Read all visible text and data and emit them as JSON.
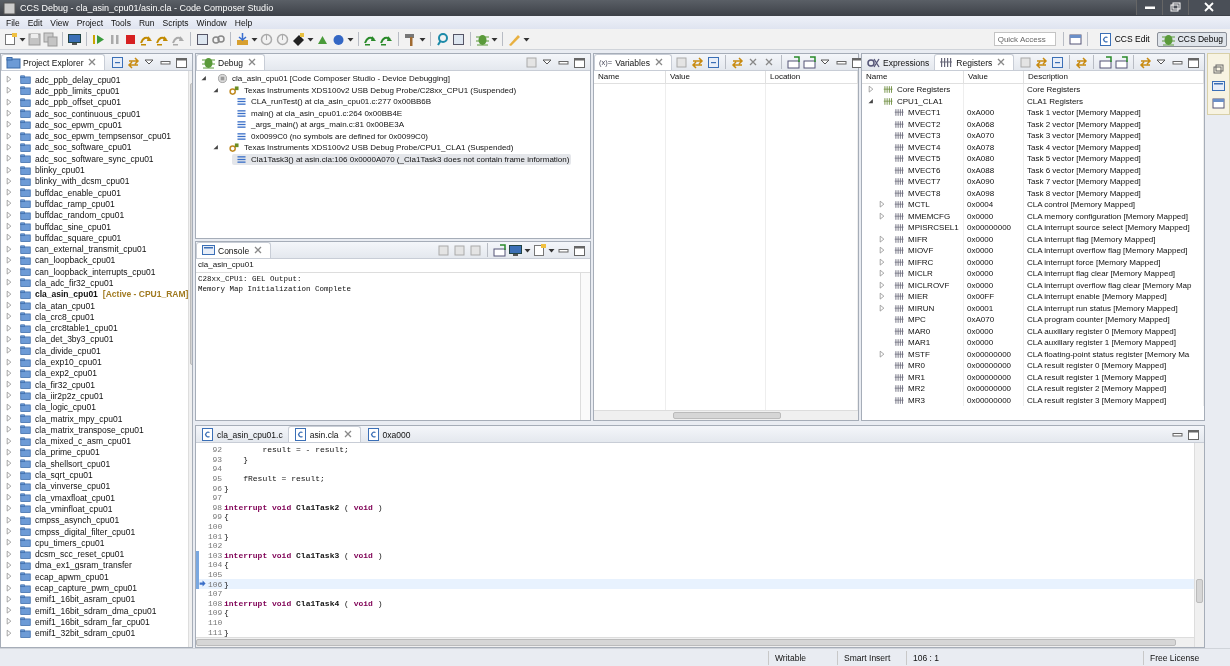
{
  "window": {
    "title": "CCS Debug - cla_asin_cpu01/asin.cla - Code Composer Studio"
  },
  "menu": [
    "File",
    "Edit",
    "View",
    "Project",
    "Tools",
    "Run",
    "Scripts",
    "Window",
    "Help"
  ],
  "quick_access": {
    "placeholder": "Quick Access"
  },
  "perspectives": [
    {
      "label": "CCS Edit",
      "selected": false
    },
    {
      "label": "CCS Debug",
      "selected": true
    }
  ],
  "project_explorer": {
    "tab": "Project Explorer",
    "items": [
      {
        "name": "adc_ppb_delay_cpu01",
        "active": false
      },
      {
        "name": "adc_ppb_limits_cpu01",
        "active": false
      },
      {
        "name": "adc_ppb_offset_cpu01",
        "active": false
      },
      {
        "name": "adc_soc_continuous_cpu01",
        "active": false
      },
      {
        "name": "adc_soc_epwm_cpu01",
        "active": false
      },
      {
        "name": "adc_soc_epwm_tempsensor_cpu01",
        "active": false
      },
      {
        "name": "adc_soc_software_cpu01",
        "active": false
      },
      {
        "name": "adc_soc_software_sync_cpu01",
        "active": false
      },
      {
        "name": "blinky_cpu01",
        "active": false
      },
      {
        "name": "blinky_with_dcsm_cpu01",
        "active": false
      },
      {
        "name": "buffdac_enable_cpu01",
        "active": false
      },
      {
        "name": "buffdac_ramp_cpu01",
        "active": false
      },
      {
        "name": "buffdac_random_cpu01",
        "active": false
      },
      {
        "name": "buffdac_sine_cpu01",
        "active": false
      },
      {
        "name": "buffdac_square_cpu01",
        "active": false
      },
      {
        "name": "can_external_transmit_cpu01",
        "active": false
      },
      {
        "name": "can_loopback_cpu01",
        "active": false
      },
      {
        "name": "can_loopback_interrupts_cpu01",
        "active": false
      },
      {
        "name": "cla_adc_fir32_cpu01",
        "active": false
      },
      {
        "name": "cla_asin_cpu01",
        "active": true,
        "annotation": "[Active - CPU1_RAM]"
      },
      {
        "name": "cla_atan_cpu01",
        "active": false
      },
      {
        "name": "cla_crc8_cpu01",
        "active": false
      },
      {
        "name": "cla_crc8table1_cpu01",
        "active": false
      },
      {
        "name": "cla_det_3by3_cpu01",
        "active": false
      },
      {
        "name": "cla_divide_cpu01",
        "active": false
      },
      {
        "name": "cla_exp10_cpu01",
        "active": false
      },
      {
        "name": "cla_exp2_cpu01",
        "active": false
      },
      {
        "name": "cla_fir32_cpu01",
        "active": false
      },
      {
        "name": "cla_iir2p2z_cpu01",
        "active": false
      },
      {
        "name": "cla_logic_cpu01",
        "active": false
      },
      {
        "name": "cla_matrix_mpy_cpu01",
        "active": false
      },
      {
        "name": "cla_matrix_transpose_cpu01",
        "active": false
      },
      {
        "name": "cla_mixed_c_asm_cpu01",
        "active": false
      },
      {
        "name": "cla_prime_cpu01",
        "active": false
      },
      {
        "name": "cla_shellsort_cpu01",
        "active": false
      },
      {
        "name": "cla_sqrt_cpu01",
        "active": false
      },
      {
        "name": "cla_vinverse_cpu01",
        "active": false
      },
      {
        "name": "cla_vmaxfloat_cpu01",
        "active": false
      },
      {
        "name": "cla_vminfloat_cpu01",
        "active": false
      },
      {
        "name": "cmpss_asynch_cpu01",
        "active": false
      },
      {
        "name": "cmpss_digital_filter_cpu01",
        "active": false
      },
      {
        "name": "cpu_timers_cpu01",
        "active": false
      },
      {
        "name": "dcsm_scc_reset_cpu01",
        "active": false
      },
      {
        "name": "dma_ex1_gsram_transfer",
        "active": false
      },
      {
        "name": "ecap_apwm_cpu01",
        "active": false
      },
      {
        "name": "ecap_capture_pwm_cpu01",
        "active": false
      },
      {
        "name": "emif1_16bit_asram_cpu01",
        "active": false
      },
      {
        "name": "emif1_16bit_sdram_dma_cpu01",
        "active": false
      },
      {
        "name": "emif1_16bit_sdram_far_cpu01",
        "active": false
      },
      {
        "name": "emif1_32bit_sdram_cpu01",
        "active": false
      }
    ]
  },
  "debug": {
    "tab": "Debug",
    "sessions": [
      {
        "label": "cla_asin_cpu01 [Code Composer Studio - Device Debugging]",
        "expanded": true,
        "threads": [
          {
            "label": "Texas Instruments XDS100v2 USB Debug Probe/C28xx_CPU1 (Suspended)",
            "expanded": true,
            "frames": [
              {
                "label": "CLA_runTest() at cla_asin_cpu01.c:277 0x00BB6B",
                "selected": false
              },
              {
                "label": "main() at cla_asin_cpu01.c:264 0x00BB4E",
                "selected": false
              },
              {
                "label": "_args_main() at args_main.c:81 0x00BE3A",
                "selected": false
              },
              {
                "label": "0x0099C0  (no symbols are defined for 0x0099C0)",
                "selected": false
              }
            ]
          },
          {
            "label": "Texas Instruments XDS100v2 USB Debug Probe/CPU1_CLA1 (Suspended)",
            "expanded": true,
            "frames": [
              {
                "label": "Cla1Task3() at asin.cla:106 0x0000A070  (_Cla1Task3 does not contain frame information)",
                "selected": true
              }
            ]
          }
        ]
      }
    ]
  },
  "console": {
    "tab": "Console",
    "name": "cla_asin_cpu01",
    "lines": [
      "C28xx_CPU1: GEL Output:",
      "Memory Map Initialization Complete"
    ]
  },
  "variables": {
    "tab": "Variables",
    "icon_text": "(x)=",
    "columns": [
      "Name",
      "Value",
      "Location"
    ]
  },
  "registers": {
    "tabs": [
      {
        "label": "Expressions",
        "selected": false
      },
      {
        "label": "Registers",
        "selected": true
      }
    ],
    "columns": [
      "Name",
      "Value",
      "Description"
    ],
    "groups": [
      {
        "name": "Core Registers",
        "description": "Core Registers",
        "expanded": false
      },
      {
        "name": "CPU1_CLA1",
        "description": "CLA1 Registers",
        "expanded": true,
        "children": [
          {
            "name": "MVECT1",
            "value": "0xA000",
            "description": "Task 1 vector [Memory Mapped]",
            "expandable": false
          },
          {
            "name": "MVECT2",
            "value": "0xA068",
            "description": "Task 2 vector [Memory Mapped]",
            "expandable": false
          },
          {
            "name": "MVECT3",
            "value": "0xA070",
            "description": "Task 3 vector [Memory Mapped]",
            "expandable": false
          },
          {
            "name": "MVECT4",
            "value": "0xA078",
            "description": "Task 4 vector [Memory Mapped]",
            "expandable": false
          },
          {
            "name": "MVECT5",
            "value": "0xA080",
            "description": "Task 5 vector [Memory Mapped]",
            "expandable": false
          },
          {
            "name": "MVECT6",
            "value": "0xA088",
            "description": "Task 6 vector [Memory Mapped]",
            "expandable": false
          },
          {
            "name": "MVECT7",
            "value": "0xA090",
            "description": "Task 7 vector [Memory Mapped]",
            "expandable": false
          },
          {
            "name": "MVECT8",
            "value": "0xA098",
            "description": "Task 8 vector [Memory Mapped]",
            "expandable": false
          },
          {
            "name": "MCTL",
            "value": "0x0004",
            "description": "CLA control [Memory Mapped]",
            "expandable": true
          },
          {
            "name": "MMEMCFG",
            "value": "0x0000",
            "description": "CLA memory configuration [Memory Mapped]",
            "expandable": true
          },
          {
            "name": "MPISRCSEL1",
            "value": "0x00000000",
            "description": "CLA interrupt source select [Memory Mapped]",
            "expandable": false
          },
          {
            "name": "MIFR",
            "value": "0x0000",
            "description": "CLA interrupt flag [Memory Mapped]",
            "expandable": true
          },
          {
            "name": "MIOVF",
            "value": "0x0000",
            "description": "CLA interrupt overflow flag [Memory Mapped]",
            "expandable": true
          },
          {
            "name": "MIFRC",
            "value": "0x0000",
            "description": "CLA interrupt force [Memory Mapped]",
            "expandable": true
          },
          {
            "name": "MICLR",
            "value": "0x0000",
            "description": "CLA interrupt flag clear [Memory Mapped]",
            "expandable": true
          },
          {
            "name": "MICLROVF",
            "value": "0x0000",
            "description": "CLA interrupt overflow flag clear [Memory Map",
            "expandable": true
          },
          {
            "name": "MIER",
            "value": "0x00FF",
            "description": "CLA interrupt enable [Memory Mapped]",
            "expandable": true
          },
          {
            "name": "MIRUN",
            "value": "0x0001",
            "description": "CLA interrupt run status [Memory Mapped]",
            "expandable": true
          },
          {
            "name": "MPC",
            "value": "0xA070",
            "description": "CLA program counter [Memory Mapped]",
            "expandable": false
          },
          {
            "name": "MAR0",
            "value": "0x0000",
            "description": "CLA auxillary register 0 [Memory Mapped]",
            "expandable": false
          },
          {
            "name": "MAR1",
            "value": "0x0000",
            "description": "CLA auxillary register 1 [Memory Mapped]",
            "expandable": false
          },
          {
            "name": "MSTF",
            "value": "0x00000000",
            "description": "CLA floating-point status register [Memory Ma",
            "expandable": true
          },
          {
            "name": "MR0",
            "value": "0x00000000",
            "description": "CLA result register 0 [Memory Mapped]",
            "expandable": false
          },
          {
            "name": "MR1",
            "value": "0x00000000",
            "description": "CLA result register 1 [Memory Mapped]",
            "expandable": false
          },
          {
            "name": "MR2",
            "value": "0x00000000",
            "description": "CLA result register 2 [Memory Mapped]",
            "expandable": false
          },
          {
            "name": "MR3",
            "value": "0x00000000",
            "description": "CLA result register 3 [Memory Mapped]",
            "expandable": false
          }
        ]
      }
    ]
  },
  "editor": {
    "tabs": [
      {
        "label": "cla_asin_cpu01.c",
        "selected": false
      },
      {
        "label": "asin.cla",
        "selected": true
      },
      {
        "label": "0xa000",
        "selected": false
      }
    ],
    "lines": [
      {
        "number": "92",
        "in_range": false,
        "current": false,
        "tokens": [
          {
            "kind": "plain",
            "text": "        result = - result;"
          }
        ]
      },
      {
        "number": "93",
        "in_range": false,
        "current": false,
        "tokens": [
          {
            "kind": "plain",
            "text": "    }"
          }
        ]
      },
      {
        "number": "94",
        "in_range": false,
        "current": false
      },
      {
        "number": "95",
        "in_range": false,
        "current": false,
        "tokens": [
          {
            "kind": "plain",
            "text": "    fResult = result;"
          }
        ]
      },
      {
        "number": "96",
        "in_range": false,
        "current": false,
        "tokens": [
          {
            "kind": "plain",
            "text": "}"
          }
        ]
      },
      {
        "number": "97",
        "in_range": false,
        "current": false
      },
      {
        "number": "98",
        "in_range": false,
        "current": false,
        "tokens": [
          {
            "kind": "keyword",
            "text": "interrupt "
          },
          {
            "kind": "keyword",
            "text": "void "
          },
          {
            "kind": "function",
            "text": "Cla1Task2"
          },
          {
            "kind": "plain",
            "text": " ( "
          },
          {
            "kind": "keyword",
            "text": "void"
          },
          {
            "kind": "plain",
            "text": " )"
          }
        ]
      },
      {
        "number": "99",
        "in_range": false,
        "current": false,
        "tokens": [
          {
            "kind": "plain",
            "text": "{"
          }
        ]
      },
      {
        "number": "100",
        "in_range": false,
        "current": false
      },
      {
        "number": "101",
        "in_range": false,
        "current": false,
        "tokens": [
          {
            "kind": "plain",
            "text": "}"
          }
        ]
      },
      {
        "number": "102",
        "in_range": false,
        "current": false
      },
      {
        "number": "103",
        "in_range": true,
        "current": false,
        "tokens": [
          {
            "kind": "keyword",
            "text": "interrupt "
          },
          {
            "kind": "keyword",
            "text": "void "
          },
          {
            "kind": "function",
            "text": "Cla1Task3"
          },
          {
            "kind": "plain",
            "text": " ( "
          },
          {
            "kind": "keyword",
            "text": "void"
          },
          {
            "kind": "plain",
            "text": " )"
          }
        ]
      },
      {
        "number": "104",
        "in_range": true,
        "current": false,
        "tokens": [
          {
            "kind": "plain",
            "text": "{"
          }
        ]
      },
      {
        "number": "105",
        "in_range": true,
        "current": false
      },
      {
        "number": "106",
        "in_range": true,
        "current": true,
        "tokens": [
          {
            "kind": "plain",
            "text": "}"
          }
        ]
      },
      {
        "number": "107",
        "in_range": false,
        "current": false
      },
      {
        "number": "108",
        "in_range": false,
        "current": false,
        "tokens": [
          {
            "kind": "keyword",
            "text": "interrupt "
          },
          {
            "kind": "keyword",
            "text": "void "
          },
          {
            "kind": "function",
            "text": "Cla1Task4"
          },
          {
            "kind": "plain",
            "text": " ( "
          },
          {
            "kind": "keyword",
            "text": "void"
          },
          {
            "kind": "plain",
            "text": " )"
          }
        ]
      },
      {
        "number": "109",
        "in_range": false,
        "current": false,
        "tokens": [
          {
            "kind": "plain",
            "text": "{"
          }
        ]
      },
      {
        "number": "110",
        "in_range": false,
        "current": false
      },
      {
        "number": "111",
        "in_range": false,
        "current": false,
        "tokens": [
          {
            "kind": "plain",
            "text": "}"
          }
        ]
      }
    ]
  },
  "status_bar": {
    "mode": "Writable",
    "insert": "Smart Insert",
    "position": "106 : 1",
    "license": "Free License"
  }
}
